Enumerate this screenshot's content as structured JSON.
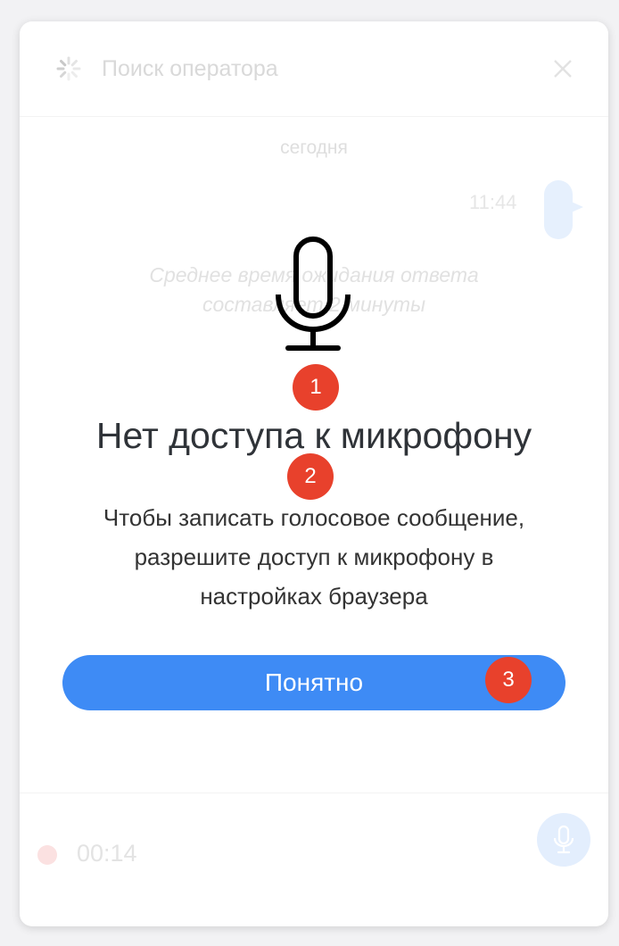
{
  "header": {
    "title": "Поиск оператора",
    "spinner_icon": "loading-spinner-icon",
    "close_icon": "close-icon"
  },
  "chat": {
    "date_separator": "сегодня",
    "message_time": "11:44",
    "wait_note_line1": "Среднее время ожидания ответа",
    "wait_note_line2": "составляет 2 минуты"
  },
  "footer": {
    "record_time": "00:14",
    "record_dot_color": "#fbe1e1",
    "mic_button_icon": "microphone-icon"
  },
  "dialog": {
    "icon": "microphone-icon",
    "title": "Нет доступа к микрофону",
    "description_line1": "Чтобы записать голосовое сообщение,",
    "description_line2": "разрешите доступ к микрофону в",
    "description_line3": "настройках браузера",
    "button_label": "Понятно",
    "button_color": "#3e8bf5"
  },
  "markers": {
    "m1": "1",
    "m2": "2",
    "m3": "3",
    "color": "#e8412c"
  }
}
